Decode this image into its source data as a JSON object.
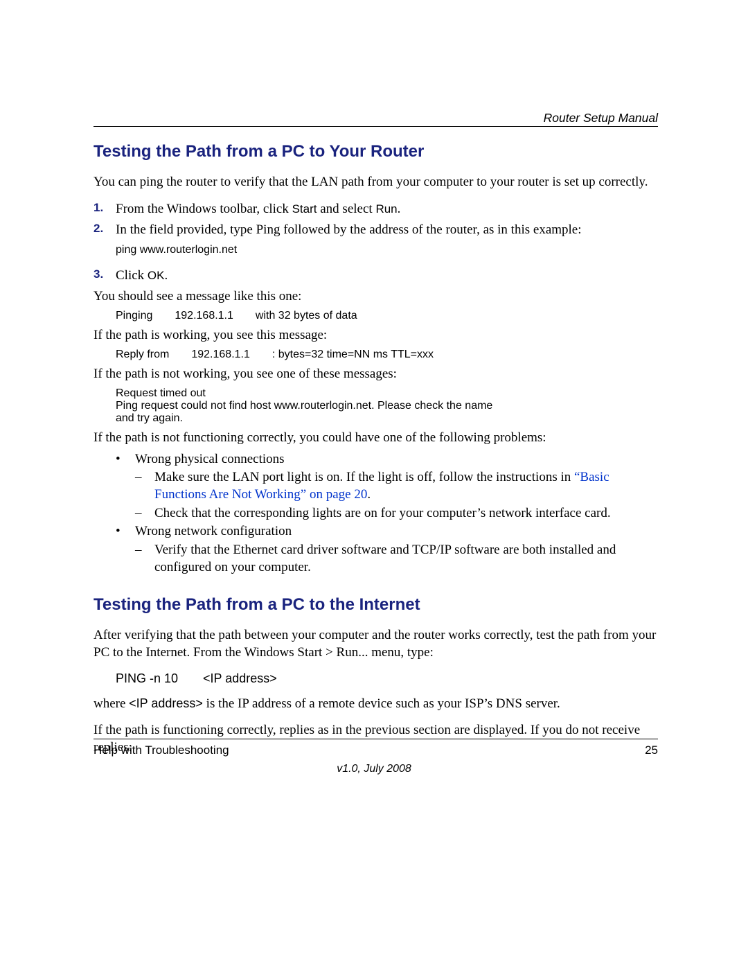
{
  "header": {
    "doc_title": "Router Setup Manual"
  },
  "section1": {
    "heading": "Testing the Path from a PC to Your Router",
    "intro": "You can ping the router to verify that the LAN path from your computer to your router is set up correctly.",
    "step1_num": "1.",
    "step1_a": "From the Windows toolbar, click ",
    "step1_start": "Start",
    "step1_b": " and select ",
    "step1_run": "Run",
    "step1_c": ".",
    "step2_num": "2.",
    "step2_text": "In the field provided, type Ping followed by the address of the router, as in this example:",
    "step2_code": "ping www.routerlogin.net",
    "step3_num": "3.",
    "step3_a": "Click ",
    "step3_ok": "OK",
    "step3_b": ".",
    "step3_msg_intro": "You should see a message like this one:",
    "step3_code1": "Pinging  192.168.1.1  with 32 bytes of data",
    "step3_working_intro": "If the path is working, you see this message:",
    "step3_code2": "Reply from  192.168.1.1  : bytes=32 time=NN ms TTL=xxx",
    "step3_notworking_intro": "If the path is not working, you see one of these messages:",
    "step3_err1": "Request timed out",
    "step3_err2": "Ping request could not find host www.routerlogin.net. Please check the name and try again.",
    "step3_diag_intro": "If the path is not functioning correctly, you could have one of the following problems:",
    "b1": "Wrong physical connections",
    "b1d1_a": "Make sure the LAN port light is on. If the light is off, follow the instructions in ",
    "b1d1_link": "“Basic Functions Are Not Working” on page 20",
    "b1d1_b": ".",
    "b1d2": "Check that the corresponding lights are on for your computer’s network interface card.",
    "b2": "Wrong network configuration",
    "b2d1": "Verify that the Ethernet card driver software and TCP/IP software are both installed and configured on your computer."
  },
  "section2": {
    "heading": "Testing the Path from a PC to the Internet",
    "p1": "After verifying that the path between your computer and the router works correctly, test the path from your PC to the Internet. From the Windows Start > Run... menu, type:",
    "cmd": "PING -n 10  <IP address>",
    "p2_a": "where ",
    "p2_ip": "<IP address>",
    "p2_b": " is the IP address of a remote device such as your ISP’s DNS server.",
    "p3": "If the path is functioning correctly, replies as in the previous section are displayed. If you do not receive replies:"
  },
  "footer": {
    "left": "Help with Troubleshooting",
    "page": "25",
    "version": "v1.0, July 2008"
  },
  "glyph": {
    "bullet": "•",
    "dash": "–"
  }
}
